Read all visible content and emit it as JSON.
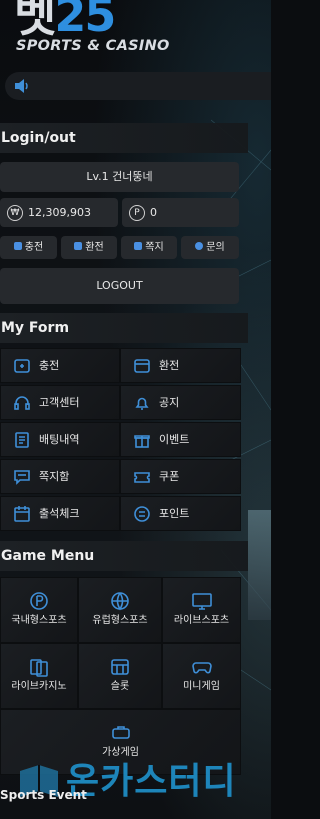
{
  "header": {
    "logo_main": "벳",
    "logo_num": "25",
    "logo_sub": "SPORTS & CASINO"
  },
  "login": {
    "title": "Login/out",
    "user_line": "Lv.1  건너뚱네",
    "money_symbol": "₩",
    "money": "12,309,903",
    "point_symbol": "P",
    "points": "0",
    "quick": [
      {
        "label": "충전",
        "icon": "plus-icon"
      },
      {
        "label": "환전",
        "icon": "minus-icon"
      },
      {
        "label": "쪽지",
        "icon": "mail-icon"
      },
      {
        "label": "문의",
        "icon": "chat-icon"
      }
    ],
    "logout_label": "LOGOUT"
  },
  "myform": {
    "title": "My Form",
    "items": [
      {
        "label": "충전",
        "icon": "wallet-in-icon"
      },
      {
        "label": "환전",
        "icon": "card-icon"
      },
      {
        "label": "고객센터",
        "icon": "headset-icon"
      },
      {
        "label": "공지",
        "icon": "bell-icon"
      },
      {
        "label": "배팅내역",
        "icon": "receipt-icon"
      },
      {
        "label": "이벤트",
        "icon": "gift-icon"
      },
      {
        "label": "쪽지함",
        "icon": "message-icon"
      },
      {
        "label": "쿠폰",
        "icon": "ticket-icon"
      },
      {
        "label": "출석체크",
        "icon": "calendar-icon"
      },
      {
        "label": "포인트",
        "icon": "point-icon"
      }
    ]
  },
  "gamemenu": {
    "title": "Game Menu",
    "items": [
      {
        "label": "국내형스포츠",
        "icon": "sports-domestic-icon"
      },
      {
        "label": "유럽형스포츠",
        "icon": "globe-sports-icon"
      },
      {
        "label": "라이브스포츠",
        "icon": "live-tv-icon"
      },
      {
        "label": "라이브카지노",
        "icon": "cards-icon"
      },
      {
        "label": "슬롯",
        "icon": "slot-icon"
      },
      {
        "label": "미니게임",
        "icon": "gamepad-icon"
      },
      {
        "label": "가상게임",
        "icon": "vr-icon"
      }
    ]
  },
  "footer": {
    "sports_event": "Sports Event",
    "watermark": "온카스터디"
  },
  "colors": {
    "accent": "#3f8fd8",
    "background": "#0b0d10",
    "box": "#26292d"
  }
}
